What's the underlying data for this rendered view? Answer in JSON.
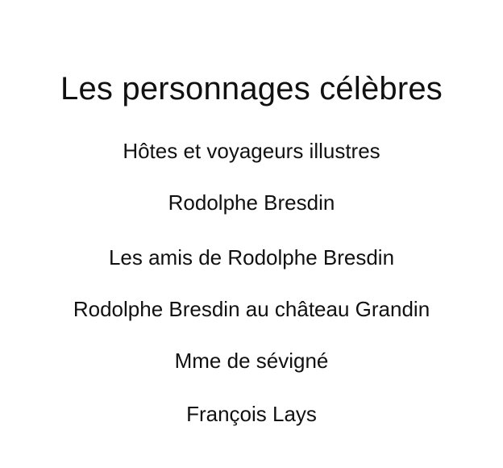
{
  "page": {
    "title": "Les personnages célèbres"
  },
  "menu": {
    "items": [
      {
        "label": "Hôtes et voyageurs illustres"
      },
      {
        "label": "Rodolphe Bresdin"
      },
      {
        "label": "Les amis de Rodolphe Bresdin"
      },
      {
        "label": "Rodolphe Bresdin au château Grandin"
      },
      {
        "label": "Mme de sévigné"
      },
      {
        "label": "François Lays"
      }
    ]
  },
  "colors": {
    "background": "#ffffff",
    "text": "#111111"
  }
}
